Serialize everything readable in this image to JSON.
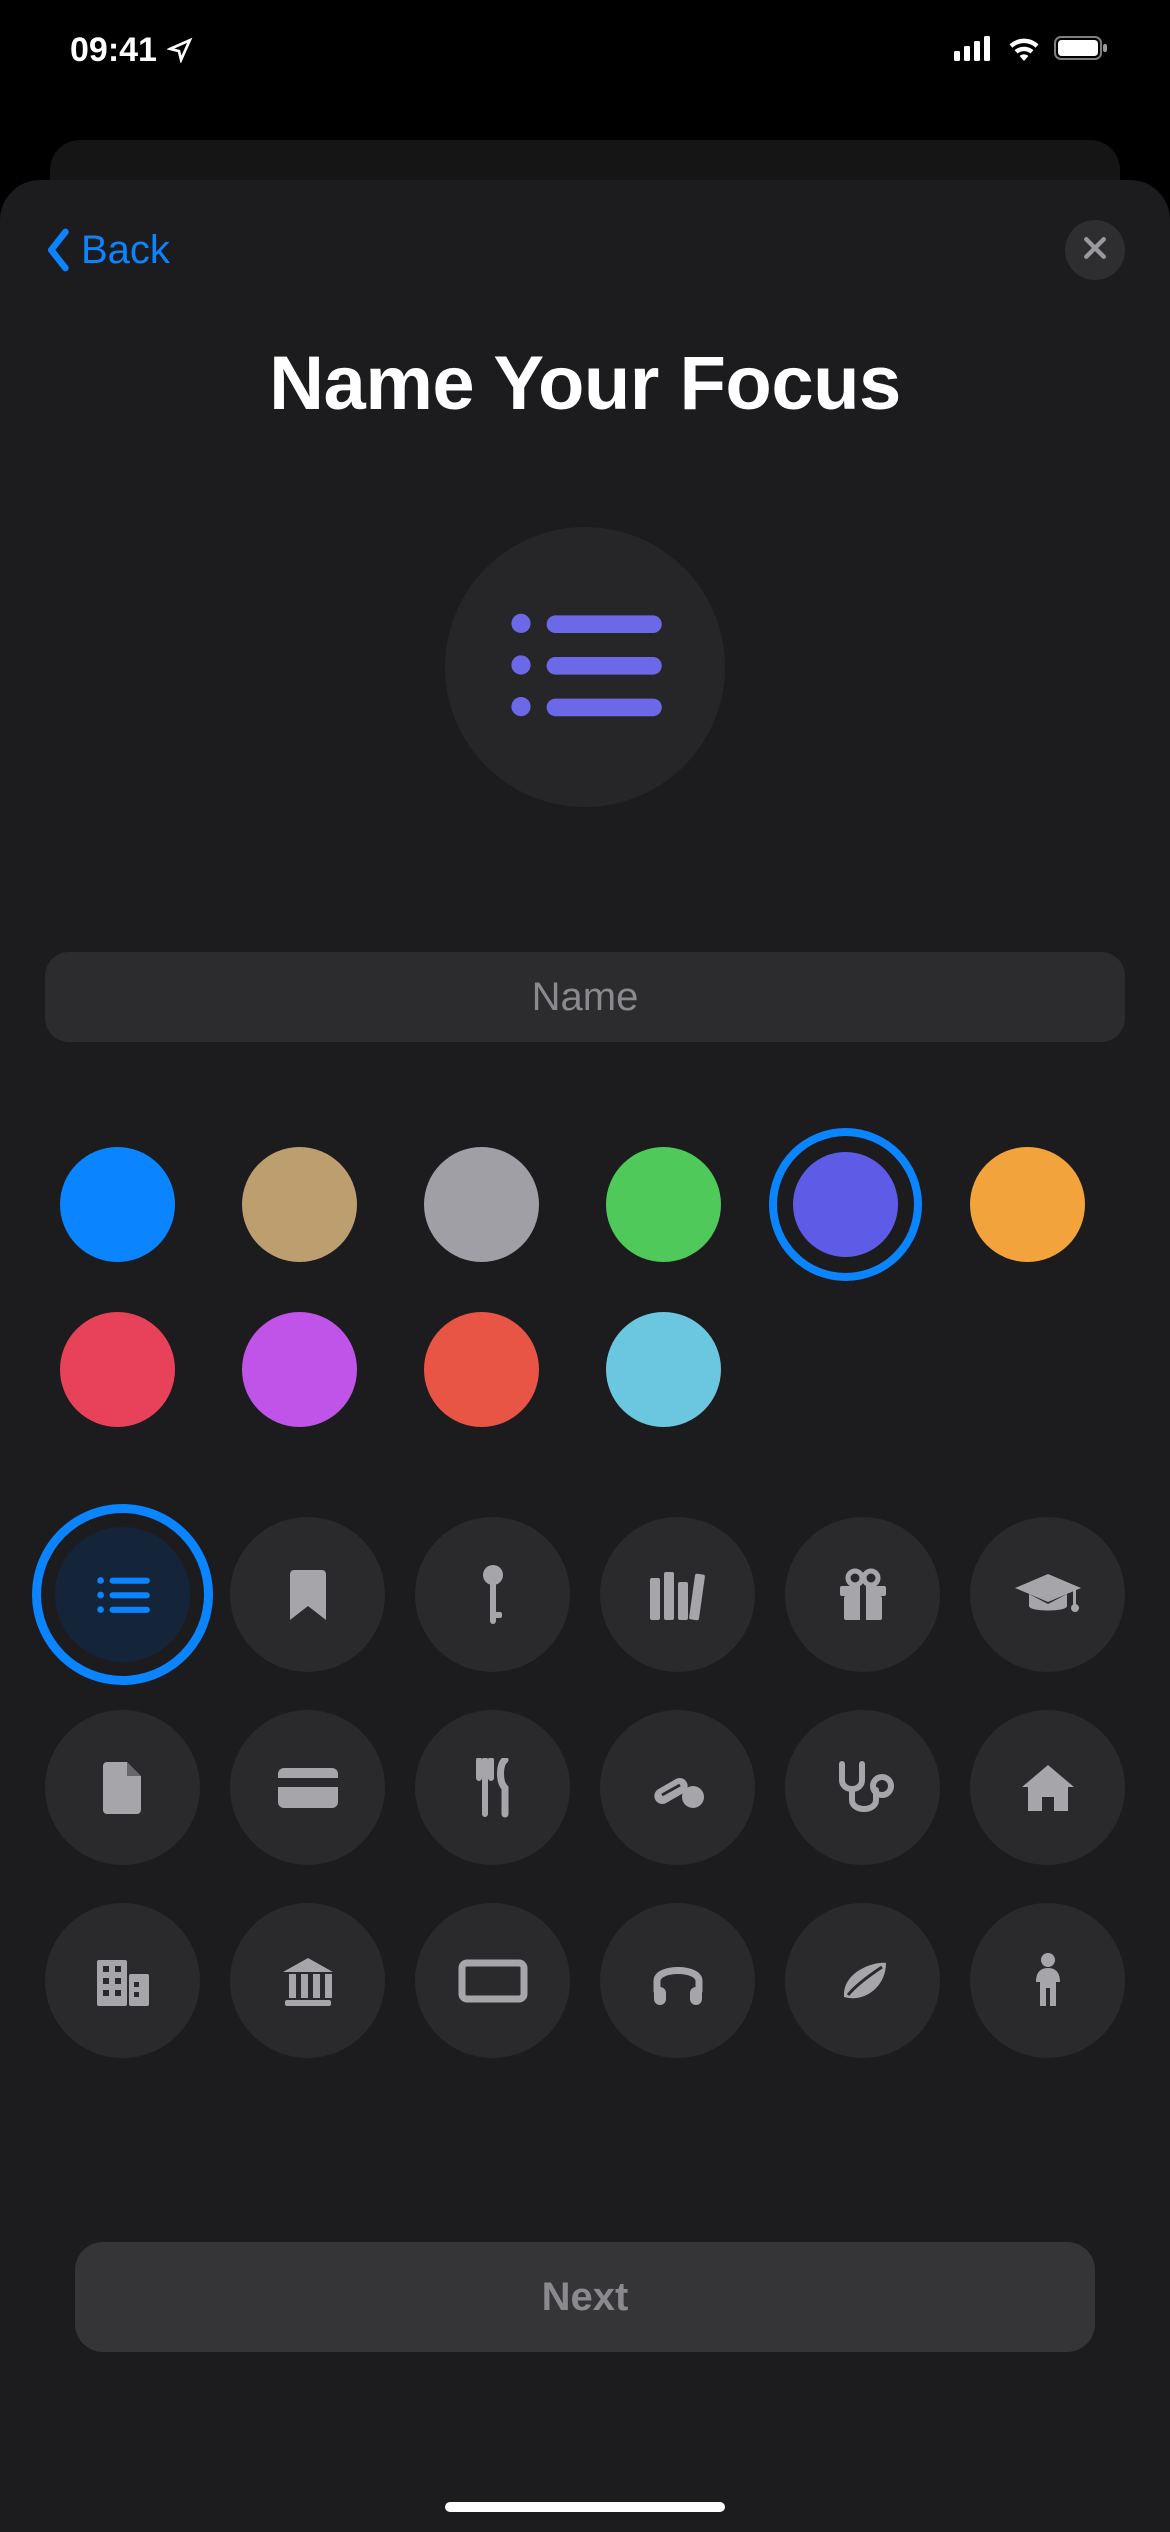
{
  "status": {
    "time": "09:41"
  },
  "nav": {
    "back_label": "Back"
  },
  "title": "Name Your Focus",
  "input": {
    "placeholder": "Name",
    "value": ""
  },
  "colors": [
    {
      "name": "blue",
      "hex": "#0a84ff",
      "selected": false
    },
    {
      "name": "tan",
      "hex": "#bd9f6f",
      "selected": false
    },
    {
      "name": "gray",
      "hex": "#9f9fa5",
      "selected": false
    },
    {
      "name": "green",
      "hex": "#4ec95a",
      "selected": false
    },
    {
      "name": "indigo",
      "hex": "#5e5ce6",
      "selected": true
    },
    {
      "name": "orange",
      "hex": "#f2a33c",
      "selected": false
    },
    {
      "name": "pink",
      "hex": "#e8425a",
      "selected": false
    },
    {
      "name": "purple",
      "hex": "#c054e8",
      "selected": false
    },
    {
      "name": "red",
      "hex": "#e85545",
      "selected": false
    },
    {
      "name": "teal",
      "hex": "#6bc7e0",
      "selected": false
    }
  ],
  "selected_color": "#5e5ce6",
  "icons": [
    {
      "name": "list",
      "selected": true
    },
    {
      "name": "bookmark",
      "selected": false
    },
    {
      "name": "key",
      "selected": false
    },
    {
      "name": "books",
      "selected": false
    },
    {
      "name": "gift",
      "selected": false
    },
    {
      "name": "grad-cap",
      "selected": false
    },
    {
      "name": "document",
      "selected": false
    },
    {
      "name": "card",
      "selected": false
    },
    {
      "name": "fork-knife",
      "selected": false
    },
    {
      "name": "pills",
      "selected": false
    },
    {
      "name": "stethoscope",
      "selected": false
    },
    {
      "name": "house",
      "selected": false
    },
    {
      "name": "buildings",
      "selected": false
    },
    {
      "name": "museum",
      "selected": false
    },
    {
      "name": "rectangle",
      "selected": false
    },
    {
      "name": "headphones",
      "selected": false
    },
    {
      "name": "leaf",
      "selected": false
    },
    {
      "name": "person",
      "selected": false
    }
  ],
  "footer": {
    "next_label": "Next"
  }
}
